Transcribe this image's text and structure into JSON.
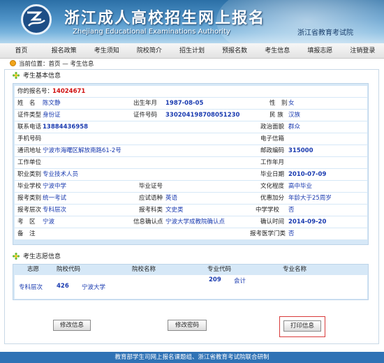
{
  "header": {
    "title": "浙江成人高校招生网上报名",
    "subtitle": "Zhejiang Educational Examinations Authority",
    "org": "浙江省教育考试院"
  },
  "nav": [
    "首页",
    "报名政策",
    "考生须知",
    "院校简介",
    "招生计划",
    "预报名数",
    "考生信息",
    "填报志愿",
    "注销登录"
  ],
  "breadcrumb": "当前位置：首页 — 考生信息",
  "basic_section_title": "考生基本信息",
  "basic": {
    "reg_no_label": "你的报名号：",
    "reg_no": "14024671",
    "name_label": "姓　名",
    "name": "陈文静",
    "birth_label": "出生年月",
    "birth": "1987-08-05",
    "gender_label": "性　别",
    "gender": "女",
    "id_type_label": "证件类型",
    "id_type": "身份证",
    "id_no_label": "证件号码",
    "id_no": "330204198708051230",
    "ethnic_label": "民 族",
    "ethnic": "汉族",
    "phone_label": "联系电话",
    "phone": "13884436958",
    "political_label": "政治面貌",
    "political": "群众",
    "mobile_label": "手机号码",
    "email_label": "电子信箱",
    "address_label": "通讯地址",
    "address": "宁波市海曙区解放南路61-2号",
    "postcode_label": "邮政编码",
    "postcode": "315000",
    "work_unit_label": "工作单位",
    "work_years_label": "工作年月",
    "occupation_label": "职业类别",
    "occupation": "专业技术人员",
    "grad_date_label": "毕业日期",
    "grad_date": "2010-07-09",
    "grad_school_label": "毕业学校",
    "grad_school": "宁波中学",
    "grad_cert_label": "毕业证号",
    "education_label": "文化程度",
    "education": "高中毕业",
    "exam_type_label": "报考类别",
    "exam_type": "统一考试",
    "foreign_lang_label": "应试语种",
    "foreign_lang": "英语",
    "bonus_label": "优惠加分",
    "bonus": "年龄大于25周岁",
    "level_label": "报考层次",
    "level": "专科层次",
    "subject_label": "报考科类",
    "subject": "文史类",
    "school_code_label": "中学学校",
    "school_code": "否",
    "district_label": "考　区",
    "district": "宁波",
    "confirm_point_label": "信息确认点",
    "confirm_point": "宁波大学成教院确认点",
    "confirm_time_label": "确认时间",
    "confirm_time": "2014-09-20",
    "note_label": "备　注",
    "medical_label": "报考医学门类",
    "medical": "否"
  },
  "vol_section_title": "考生志愿信息",
  "vol": {
    "headers": [
      "志愿",
      "院校代码",
      "院校名称",
      "专业代码",
      "专业名称"
    ],
    "row": {
      "level": "专科层次",
      "school_code": "426",
      "school_name": "宁波大学",
      "major_code": "209",
      "major_name": "会计"
    }
  },
  "buttons": {
    "edit_info": "修改信息",
    "edit_password": "修改密码",
    "print": "打印信息"
  },
  "footer": "教育部学生司网上报名课题组、浙江省教育考试院联合研制"
}
